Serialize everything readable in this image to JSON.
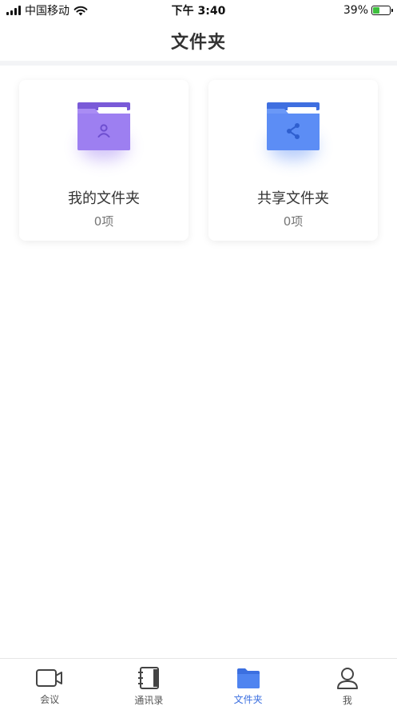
{
  "status_bar": {
    "carrier": "中国移动",
    "time": "下午 3:40",
    "battery_percent": "39%",
    "battery_level": 0.39,
    "battery_color": "#3dbf3d"
  },
  "nav": {
    "title": "文件夹"
  },
  "folders": [
    {
      "name": "我的文件夹",
      "count": "0项",
      "icon": "person-folder-icon",
      "color": "#9b7cf0"
    },
    {
      "name": "共享文件夹",
      "count": "0项",
      "icon": "share-folder-icon",
      "color": "#5c8df5"
    }
  ],
  "tab_bar": {
    "active_color": "#3b6fe0",
    "tabs": [
      {
        "label": "会议",
        "icon": "video-camera-icon"
      },
      {
        "label": "通讯录",
        "icon": "address-book-icon"
      },
      {
        "label": "文件夹",
        "icon": "folder-icon",
        "active": true
      },
      {
        "label": "我",
        "icon": "person-icon"
      }
    ]
  }
}
